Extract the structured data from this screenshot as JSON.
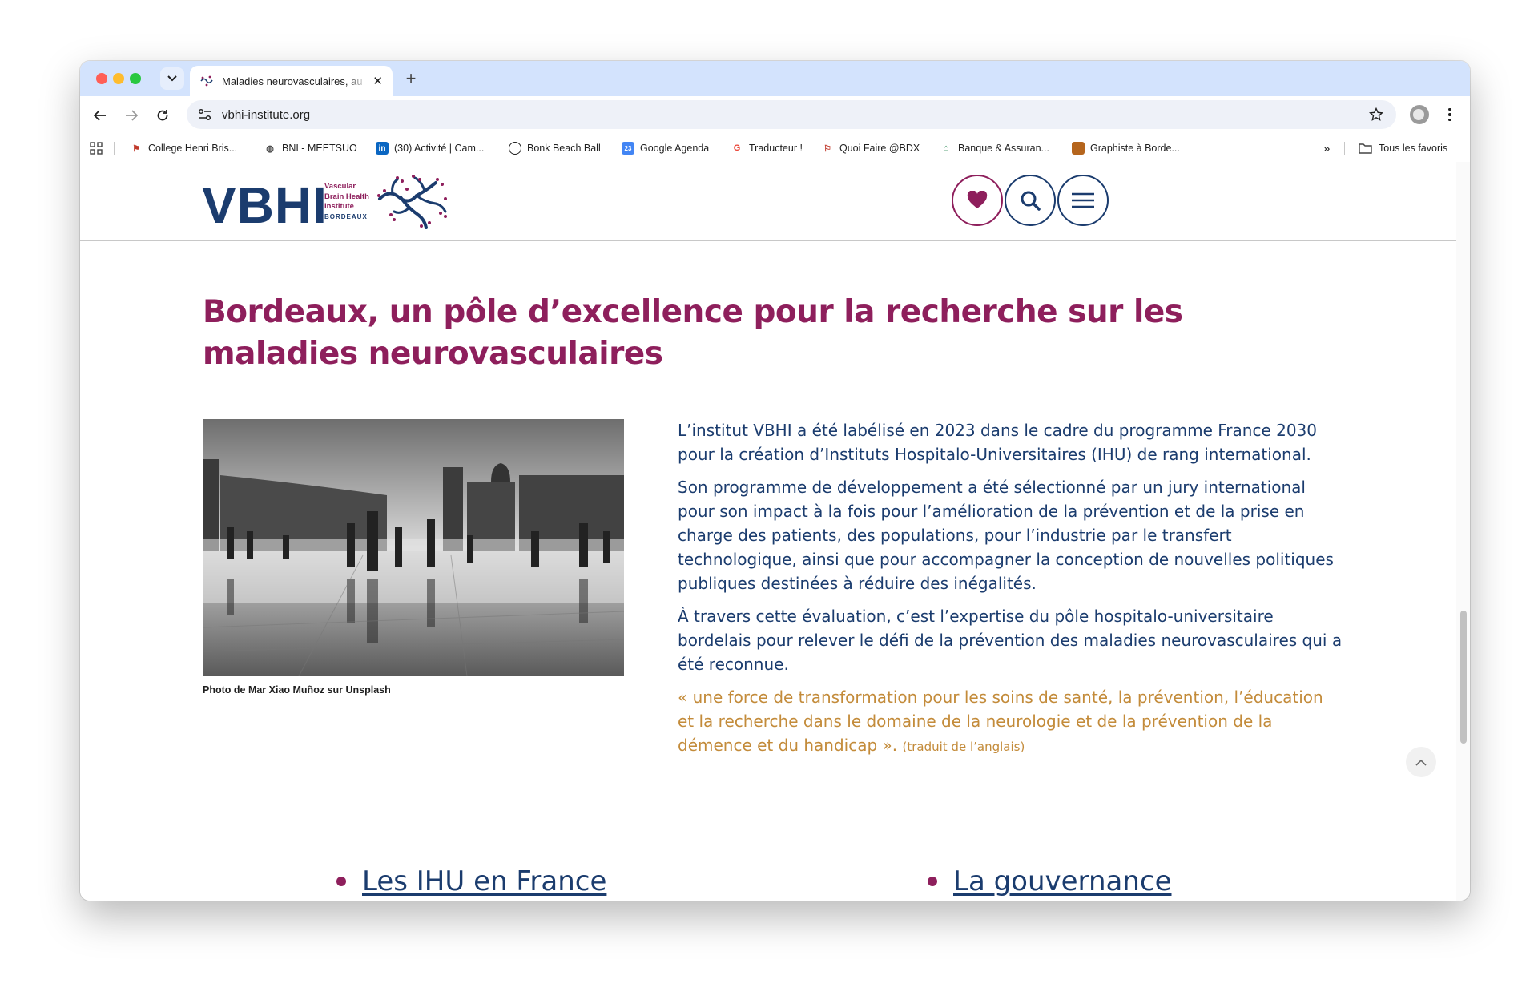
{
  "browser": {
    "tab_title": "Maladies neurovasculaires, au",
    "tab_close": "✕",
    "new_tab": "+",
    "url": "vbhi-institute.org",
    "bookmarks": [
      {
        "label": "College Henri Bris...",
        "icon": "college-icon",
        "color": "#c0392b"
      },
      {
        "label": "BNI - MEETSUO",
        "icon": "globe-icon",
        "color": "#444444"
      },
      {
        "label": "(30) Activité | Cam...",
        "icon": "linkedin-icon",
        "color": "#0a66c2"
      },
      {
        "label": "Bonk Beach Ball",
        "icon": "ball-icon",
        "color": "#1f1f1f"
      },
      {
        "label": "Google Agenda",
        "icon": "calendar-icon",
        "color": "#4285f4"
      },
      {
        "label": "Traducteur !",
        "icon": "google-icon",
        "color": "#ea4335"
      },
      {
        "label": "Quoi Faire @BDX",
        "icon": "quoi-faire-icon",
        "color": "#c0392b"
      },
      {
        "label": "Banque & Assuran...",
        "icon": "bank-icon",
        "color": "#2e8b57"
      },
      {
        "label": "Graphiste à Borde...",
        "icon": "graphiste-icon",
        "color": "#b5651d"
      }
    ],
    "bookmarks_overflow": "»",
    "all_bookmarks": "Tous les favoris"
  },
  "site": {
    "logo_text": "VBHI",
    "logo_sub": [
      "Vascular",
      "Brain Health",
      "Institute",
      "BORDEAUX"
    ],
    "brand_color": "#8e1f5c",
    "navy_color": "#1b3c6e",
    "gold_color": "#c38b3a"
  },
  "main": {
    "heading": "Bordeaux, un pôle d’excellence pour la recherche sur les maladies neurovasculaires",
    "photo_caption": "Photo de Mar Xiao Muñoz sur Unsplash",
    "paragraphs": [
      "L’institut VBHI a été labélisé en 2023 dans le cadre du programme France 2030 pour la création d’Instituts Hospitalo-Universitaires (IHU) de rang international.",
      "Son programme de développement a été sélectionné par un jury international pour son impact à la fois pour l’amélioration de la prévention et de la prise en charge des patients, des populations, pour l’industrie par le transfert technologique, ainsi que pour accompagner la conception de nouvelles politiques publiques destinées à réduire des inégalités.",
      "À travers cette évaluation, c’est l’expertise du pôle hospitalo-universitaire bordelais pour relever le défi de la prévention des maladies neurovasculaires qui a été reconnue."
    ],
    "quote": "« une force de transformation pour les soins de santé, la prévention, l’éducation et la recherche dans le domaine de la neurologie et de la prévention de la démence et du handicap ».",
    "quote_note": "(traduit de l’anglais)",
    "links": [
      "Les IHU en France",
      "La gouvernance"
    ]
  }
}
